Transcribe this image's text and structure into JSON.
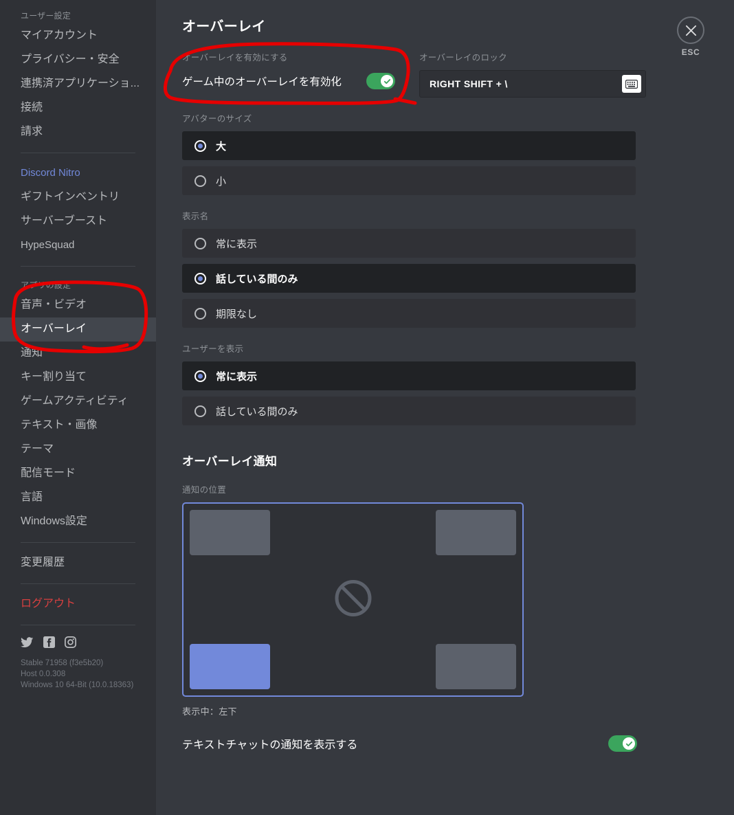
{
  "sidebar": {
    "user_settings_header": "ユーザー設定",
    "user_items": [
      {
        "label": "マイアカウント"
      },
      {
        "label": "プライバシー・安全"
      },
      {
        "label": "連携済アプリケーショ..."
      },
      {
        "label": "接続"
      },
      {
        "label": "請求"
      }
    ],
    "nitro_label": "Discord Nitro",
    "nitro_items": [
      {
        "label": "ギフトインベントリ"
      },
      {
        "label": "サーバーブースト"
      },
      {
        "label": "HypeSquad"
      }
    ],
    "app_settings_header": "アプリの設定",
    "app_items": [
      {
        "label": "音声・ビデオ",
        "selected": false
      },
      {
        "label": "オーバーレイ",
        "selected": true
      },
      {
        "label": "通知",
        "selected": false
      },
      {
        "label": "キー割り当て",
        "selected": false
      },
      {
        "label": "ゲームアクティビティ",
        "selected": false
      },
      {
        "label": "テキスト・画像",
        "selected": false
      },
      {
        "label": "テーマ",
        "selected": false
      },
      {
        "label": "配信モード",
        "selected": false
      },
      {
        "label": "言語",
        "selected": false
      },
      {
        "label": "Windows設定",
        "selected": false
      }
    ],
    "changelog_label": "変更履歴",
    "logout_label": "ログアウト",
    "social_icons": [
      "twitter-icon",
      "facebook-icon",
      "instagram-icon"
    ],
    "version": {
      "line1": "Stable 71958 (f3e5b20)",
      "line2": "Host 0.0.308",
      "line3": "Windows 10 64-Bit (10.0.18363)"
    }
  },
  "close": {
    "icon": "close-icon",
    "label": "ESC"
  },
  "main": {
    "page_title": "オーバーレイ",
    "enable_section": {
      "label": "オーバーレイを有効にする",
      "toggle_label": "ゲーム中のオーバーレイを有効化",
      "toggle_on": true,
      "toggle_color": "#3ba55d"
    },
    "lock_section": {
      "label": "オーバーレイのロック",
      "keybind_value": "RIGHT SHIFT + \\",
      "keyboard_button_icon": "keyboard-icon"
    },
    "avatar_size": {
      "label": "アバターのサイズ",
      "options": [
        {
          "label": "大",
          "selected": true
        },
        {
          "label": "小",
          "selected": false
        }
      ]
    },
    "display_name": {
      "label": "表示名",
      "options": [
        {
          "label": "常に表示",
          "selected": false
        },
        {
          "label": "話している間のみ",
          "selected": true
        },
        {
          "label": "期限なし",
          "selected": false
        }
      ]
    },
    "show_users": {
      "label": "ユーザーを表示",
      "options": [
        {
          "label": "常に表示",
          "selected": true
        },
        {
          "label": "話している間のみ",
          "selected": false
        }
      ]
    },
    "notification": {
      "title": "オーバーレイ通知",
      "position_label": "通知の位置",
      "cells": [
        {
          "position": "top-left",
          "selected": false
        },
        {
          "position": "top-right",
          "selected": false
        },
        {
          "position": "bottom-left",
          "selected": true
        },
        {
          "position": "bottom-right",
          "selected": false
        }
      ],
      "center_icon": "prohibition-icon",
      "caption": "表示中：左下",
      "accent_color": "#7289da",
      "text_chat_label": "テキストチャットの通知を表示する",
      "text_chat_on": true
    }
  },
  "annotations": {
    "color": "#e60000",
    "marks": [
      "circle-around-enable-toggle",
      "circle-around-overlay-sidebar-items"
    ]
  }
}
